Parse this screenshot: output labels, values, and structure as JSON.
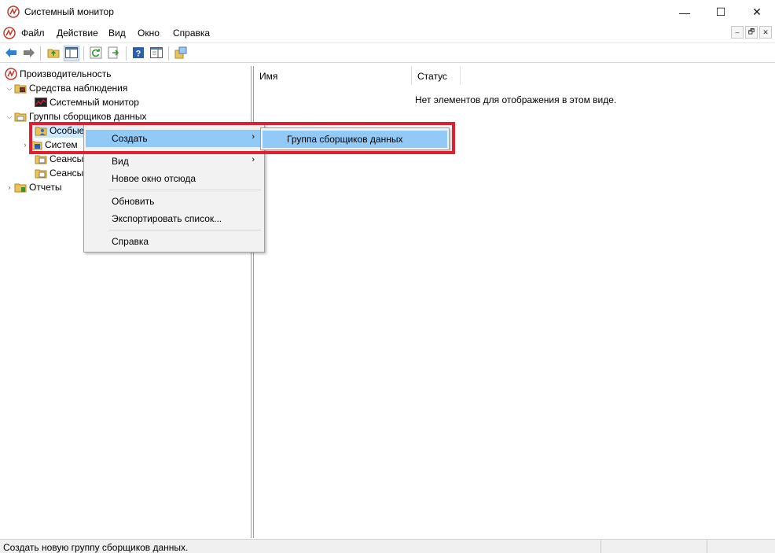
{
  "window": {
    "title": "Системный монитор",
    "controls": {
      "minimize": "—",
      "maximize": "☐",
      "close": "✕"
    }
  },
  "menubar": {
    "items": [
      "Файл",
      "Действие",
      "Вид",
      "Окно",
      "Справка"
    ],
    "mdi": {
      "minimize": "–",
      "restore": "🗗",
      "close": "✕"
    }
  },
  "toolbar": {
    "buttons": [
      "back-icon",
      "forward-icon",
      "up-folder-icon",
      "show-hide-tree-icon",
      "refresh-icon",
      "export-icon",
      "help-icon",
      "properties-icon",
      "new-window-icon"
    ]
  },
  "tree": {
    "root": "Производительность",
    "monitoring_tools": "Средства наблюдения",
    "system_monitor": "Системный монитор",
    "collector_sets": "Группы сборщиков данных",
    "user_defined": "Особые",
    "system": "Систем",
    "sessions1": "Сеансы",
    "sessions2": "Сеансы",
    "reports": "Отчеты"
  },
  "list": {
    "columns": [
      "Имя",
      "Статус"
    ],
    "empty_message": "Нет элементов для отображения в этом виде."
  },
  "context_menu": {
    "create": "Создать",
    "view": "Вид",
    "new_window": "Новое окно отсюда",
    "refresh": "Обновить",
    "export": "Экспортировать список...",
    "help": "Справка",
    "submenu_arrow": "›"
  },
  "submenu": {
    "data_collector_set": "Группа сборщиков данных"
  },
  "statusbar": {
    "text": "Создать новую группу сборщиков данных."
  },
  "colors": {
    "highlight": "#91c9f7",
    "annotation_box": "#e0202e"
  }
}
